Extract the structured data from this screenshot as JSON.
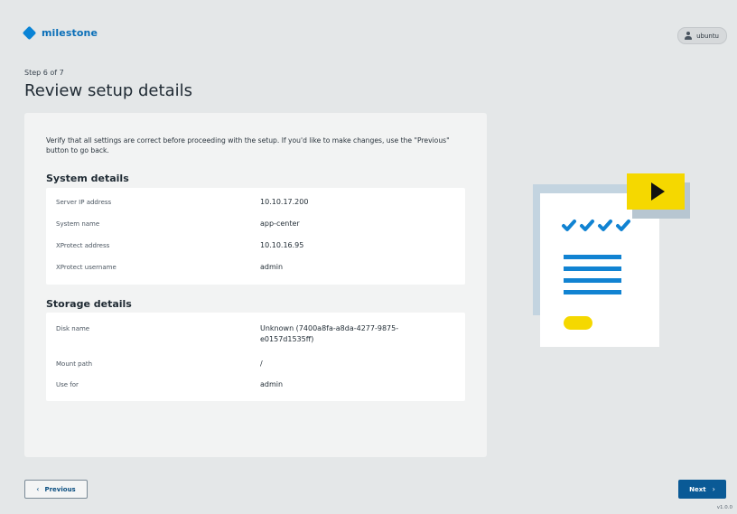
{
  "brand": {
    "name": "milestone",
    "color": "#0a84d6"
  },
  "user": {
    "name": "ubuntu",
    "icon": "user-icon"
  },
  "step": "Step 6 of 7",
  "title": "Review setup details",
  "intro": "Verify that all settings are correct before proceeding with the setup. If you'd like to make changes, use the \"Previous\" button to go back.",
  "system": {
    "heading": "System details",
    "rows": [
      {
        "label": "Server IP address",
        "value": "10.10.17.200"
      },
      {
        "label": "System name",
        "value": "app-center"
      },
      {
        "label": "XProtect address",
        "value": "10.10.16.95"
      },
      {
        "label": "XProtect username",
        "value": "admin"
      }
    ]
  },
  "storage": {
    "heading": "Storage details",
    "rows": [
      {
        "label": "Disk name",
        "value": "Unknown (7400a8fa-a8da-4277-9875-e0157d1535ff)"
      },
      {
        "label": "Mount path",
        "value": "/"
      },
      {
        "label": "Use for",
        "value": "admin"
      }
    ]
  },
  "buttons": {
    "previous": "Previous",
    "next": "Next"
  },
  "version": "v1.0.0",
  "colors": {
    "primary": "#0a5a96",
    "accent_yellow": "#f5d800",
    "background": "#e4e7e8"
  }
}
